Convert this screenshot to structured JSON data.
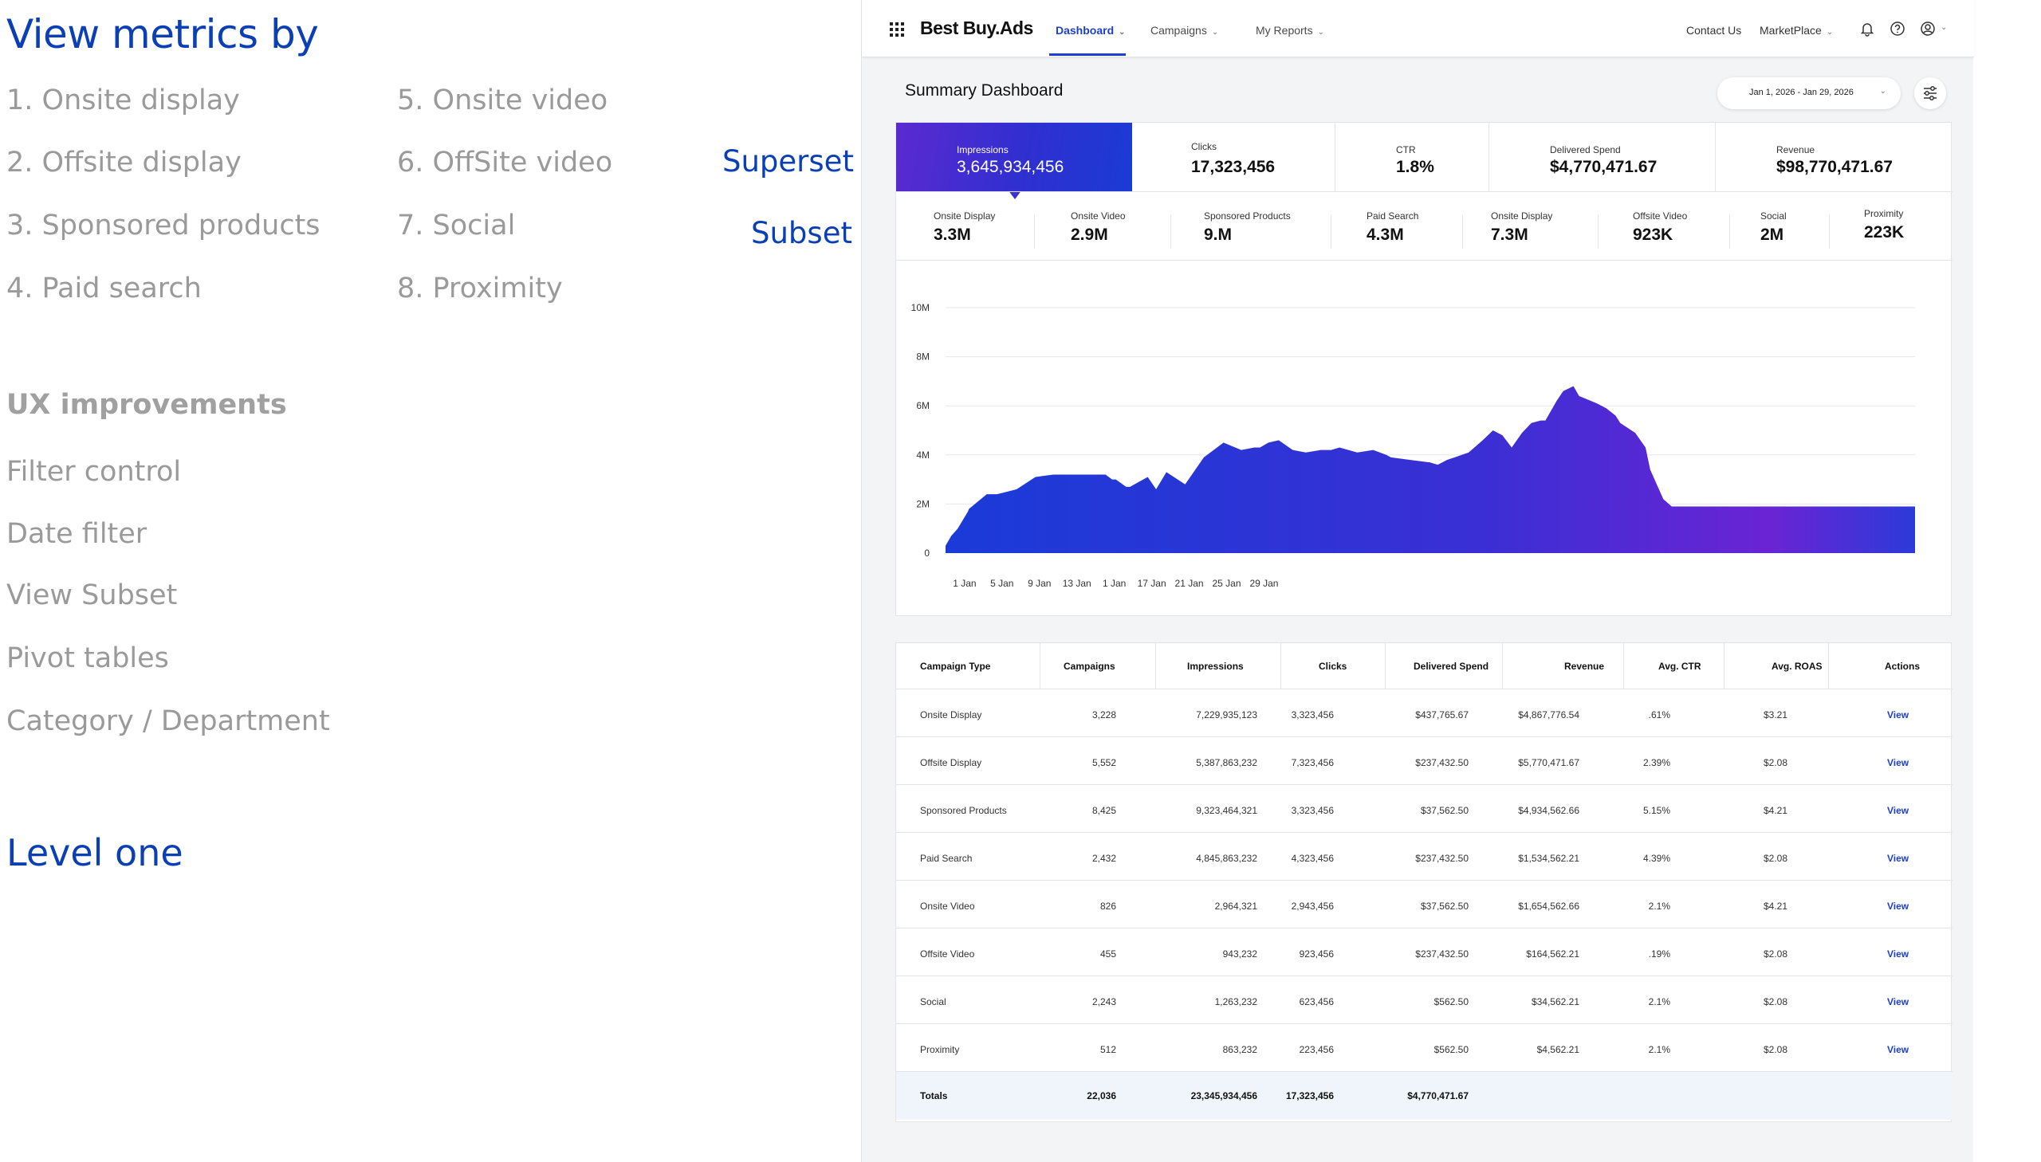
{
  "annotations": {
    "title": "View metrics by",
    "metrics_col1": [
      "1. Onsite display",
      "2. Offsite display",
      "3. Sponsored products",
      "4. Paid search"
    ],
    "metrics_col2": [
      "5. Onsite video",
      "6. OffSite video",
      "7. Social",
      "8. Proximity"
    ],
    "ux_heading": "UX improvements",
    "ux_items": [
      "Filter control",
      "Date filter",
      "View Subset",
      "Pivot tables",
      "Category / Department"
    ],
    "level": "Level one",
    "callout_superset": "Superset",
    "callout_subset": "Subset"
  },
  "app": {
    "brand": "Best Buy.Ads",
    "nav": [
      "Dashboard",
      "Campaigns",
      "My Reports"
    ],
    "contact": "Contact Us",
    "marketplace": "MarketPlace",
    "page_title": "Summary Dashboard",
    "date_range": "Jan 1, 2026  -  Jan 29, 2026"
  },
  "kpis": [
    {
      "label": "Impressions",
      "value": "3,645,934,456"
    },
    {
      "label": "Clicks",
      "value": "17,323,456"
    },
    {
      "label": "CTR",
      "value": "1.8%"
    },
    {
      "label": "Delivered Spend",
      "value": "$4,770,471.67"
    },
    {
      "label": "Revenue",
      "value": "$98,770,471.67"
    }
  ],
  "subset": [
    {
      "label": "Onsite Display",
      "value": "3.3M"
    },
    {
      "label": "Onsite Video",
      "value": "2.9M"
    },
    {
      "label": "Sponsored Products",
      "value": "9.M"
    },
    {
      "label": "Paid Search",
      "value": "4.3M"
    },
    {
      "label": "Onsite Display",
      "value": "7.3M"
    },
    {
      "label": "Offsite Video",
      "value": "923K"
    },
    {
      "label": "Social",
      "value": "2M"
    },
    {
      "label": "Proximity",
      "value": "223K"
    }
  ],
  "chart_data": {
    "type": "area",
    "title": "",
    "xlabel": "",
    "ylabel": "",
    "ylim": [
      0,
      10000000
    ],
    "y_ticks": [
      "0",
      "2M",
      "4M",
      "6M",
      "8M",
      "10M"
    ],
    "y_tick_values": [
      0,
      2000000,
      4000000,
      6000000,
      8000000,
      10000000
    ],
    "x_ticks": [
      "1 Jan",
      "5 Jan",
      "9 Jan",
      "13 Jan",
      "1 Jan",
      "17 Jan",
      "21 Jan",
      "25 Jan",
      "29 Jan"
    ],
    "x_tick_positions": [
      0.5,
      4.5,
      8.5,
      12.5,
      16.5,
      20.5,
      24.5,
      28.5,
      32.5
    ],
    "x": [
      0,
      0.6,
      1.3,
      2.4,
      2.5,
      4.4,
      5.5,
      7.6,
      9.6,
      11.5,
      13.6,
      15.6,
      16.8,
      17.1,
      17.8,
      18.2,
      19.3,
      19.7,
      21.6,
      22.5,
      23.6,
      25.6,
      27.6,
      29.7,
      31.6,
      33.0,
      33.6,
      34.5,
      35.6,
      37.1,
      38.5,
      40.1,
      41.2,
      42.1,
      44.0,
      45.7,
      47.1,
      47.6,
      49.6,
      51.6,
      51.7,
      52.6,
      53.6,
      54.4,
      55.9,
      57.4,
      58.5,
      59.5,
      60.5,
      61.6,
      62.6,
      63.6,
      64.1,
      65.3,
      66.0,
      67.1,
      67.7,
      69.6,
      70.6,
      71.6,
      72.1,
      73.7,
      74.8,
      75.3,
      76.7,
      77.6,
      78.6,
      79.6,
      80.6,
      81.6,
      82.6,
      83.6,
      84.6,
      85.6,
      86.6,
      87.6,
      88.6,
      89.6,
      90.6,
      91.6,
      92.6,
      93.6,
      94.6,
      95.6,
      96.6,
      97.6,
      98.6,
      99.6,
      100.6,
      101.6,
      102.6,
      103.6
    ],
    "series": [
      {
        "values": [
          0.3,
          0.7,
          1.0,
          1.7,
          1.8,
          2.4,
          2.4,
          2.6,
          3.1,
          3.2,
          3.2,
          3.2,
          3.2,
          3.2,
          3.0,
          3.0,
          2.7,
          2.7,
          3.1,
          2.6,
          3.3,
          2.8,
          3.9,
          4.5,
          4.2,
          4.3,
          4.3,
          4.5,
          4.6,
          4.2,
          4.1,
          4.2,
          4.2,
          4.3,
          4.1,
          4.2,
          4.0,
          3.9,
          3.8,
          3.7,
          3.7,
          3.6,
          3.8,
          3.9,
          4.1,
          4.6,
          5.0,
          4.8,
          4.3,
          4.9,
          5.3,
          5.4,
          5.4,
          6.2,
          6.6,
          6.8,
          6.4,
          6.1,
          5.9,
          5.6,
          5.3,
          4.9,
          4.3,
          3.4,
          2.2,
          1.9,
          1.9,
          1.9,
          1.9,
          1.9,
          1.9,
          1.9,
          1.9,
          1.9,
          1.9,
          1.9,
          1.9,
          1.9,
          1.9,
          1.9,
          1.9,
          1.9,
          1.9,
          1.9,
          1.9,
          1.9,
          1.9,
          1.9,
          1.9,
          1.9,
          1.9,
          1.9
        ]
      }
    ]
  },
  "table": {
    "headers": [
      "Campaign Type",
      "Campaigns",
      "Impressions",
      "Clicks",
      "Delivered Spend",
      "Revenue",
      "Avg. CTR",
      "Avg. ROAS",
      "Actions"
    ],
    "rows": [
      [
        "Onsite Display",
        "3,228",
        "7,229,935,123",
        "3,323,456",
        "$437,765.67",
        "$4,867,776.54",
        ".61%",
        "$3.21",
        "View"
      ],
      [
        "Offsite Display",
        "5,552",
        "5,387,863,232",
        "7,323,456",
        "$237,432.50",
        "$5,770,471.67",
        "2.39%",
        "$2.08",
        "View"
      ],
      [
        "Sponsored Products",
        "8,425",
        "9,323,464,321",
        "3,323,456",
        "$37,562.50",
        "$4,934,562.66",
        "5.15%",
        "$4.21",
        "View"
      ],
      [
        "Paid Search",
        "2,432",
        "4,845,863,232",
        "4,323,456",
        "$237,432.50",
        "$1,534,562.21",
        "4.39%",
        "$2.08",
        "View"
      ],
      [
        "Onsite Video",
        "826",
        "2,964,321",
        "2,943,456",
        "$37,562.50",
        "$1,654,562.66",
        "2.1%",
        "$4.21",
        "View"
      ],
      [
        "Offsite Video",
        "455",
        "943,232",
        "923,456",
        "$237,432.50",
        "$164,562.21",
        ".19%",
        "$2.08",
        "View"
      ],
      [
        "Social",
        "2,243",
        "1,263,232",
        "623,456",
        "$562.50",
        "$34,562.21",
        "2.1%",
        "$2.08",
        "View"
      ],
      [
        "Proximity",
        "512",
        "863,232",
        "223,456",
        "$562.50",
        "$4,562.21",
        "2.1%",
        "$2.08",
        "View"
      ]
    ],
    "totals": [
      "Totals",
      "22,036",
      "23,345,934,456",
      "17,323,456",
      "$4,770,471.67"
    ]
  },
  "colors": {
    "accent": "#1d3fcf",
    "annotation_blue": "#0b3fb5",
    "gradient_start": "#6a24d4",
    "gradient_end": "#1a3bd8"
  }
}
